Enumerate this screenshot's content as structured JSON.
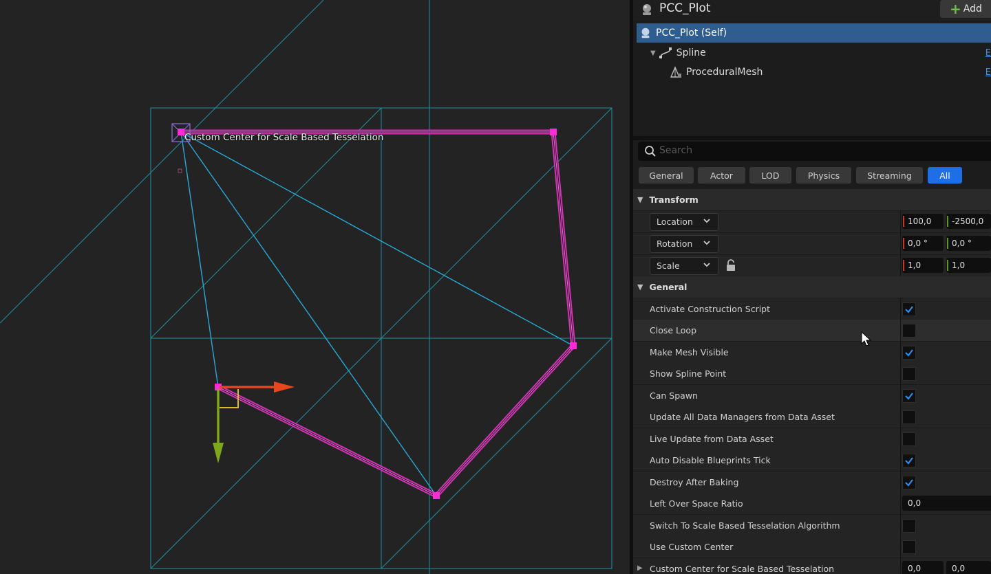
{
  "viewport": {
    "label": "Custom Center for Scale Based Tesselation",
    "colors": {
      "background": "#232323",
      "grid": "#1fa3b6",
      "spline": "#e636c8",
      "point": "#ff2bd6",
      "x_axis": "#e8461e",
      "y_axis": "#7ea81c"
    }
  },
  "details": {
    "title": "PCC_Plot",
    "add_label": "Add",
    "tree": [
      {
        "label": "PCC_Plot (Self)",
        "icon": "actor-icon",
        "selected": true
      },
      {
        "label": "Spline",
        "icon": "spline-icon",
        "link": "E"
      },
      {
        "label": "ProceduralMesh",
        "icon": "procedural-mesh-icon",
        "link": "E"
      }
    ],
    "search_placeholder": "Search",
    "tabs": [
      "General",
      "Actor",
      "LOD",
      "Physics",
      "Streaming",
      "All"
    ],
    "active_tab": "All",
    "transform": {
      "header": "Transform",
      "location": {
        "label": "Location",
        "x": "100,0",
        "y": "-2500,0"
      },
      "rotation": {
        "label": "Rotation",
        "x": "0,0 °",
        "y": "0,0 °"
      },
      "scale": {
        "label": "Scale",
        "x": "1,0",
        "y": "1,0"
      }
    },
    "general": {
      "header": "General",
      "rows": [
        {
          "name": "Activate Construction Script",
          "checked": true
        },
        {
          "name": "Close Loop",
          "checked": false
        },
        {
          "name": "Make Mesh Visible",
          "checked": true
        },
        {
          "name": "Show Spline Point",
          "checked": false
        },
        {
          "name": "Can Spawn",
          "checked": true
        },
        {
          "name": "Update All Data Managers from Data Asset",
          "checked": false
        },
        {
          "name": "Live Update from Data Asset",
          "checked": false
        },
        {
          "name": "Auto Disable Blueprints Tick",
          "checked": true
        },
        {
          "name": "Destroy After Baking",
          "checked": true
        },
        {
          "name": "Left Over Space Ratio",
          "value": "0,0"
        },
        {
          "name": "Switch To Scale Based Tesselation Algorithm",
          "checked": false
        },
        {
          "name": "Use Custom Center",
          "checked": false
        },
        {
          "name": "Custom Center for Scale Based Tesselation",
          "x": "0,0",
          "y": "0,0"
        }
      ]
    },
    "accent": "#1e6ee6"
  }
}
